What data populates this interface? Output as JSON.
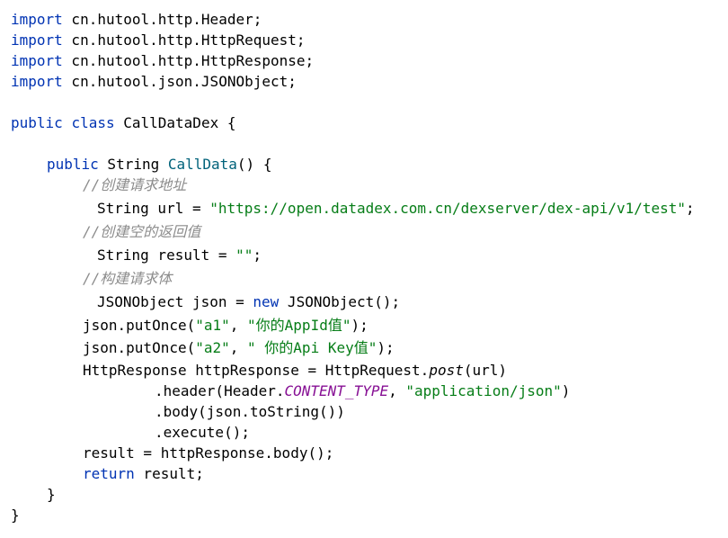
{
  "code": {
    "kw_import": "import",
    "imports": [
      " cn.hutool.http.Header;",
      " cn.hutool.http.HttpRequest;",
      " cn.hutool.http.HttpResponse;",
      " cn.hutool.json.JSONObject;"
    ],
    "kw_public": "public",
    "kw_class": "class",
    "class_name": " CallDataDex {",
    "method_return": " String ",
    "method_name": "CallData",
    "method_tail": "() {",
    "comment1": "//创建请求地址",
    "url_decl": "String url = ",
    "url_value": "\"https://open.datadex.com.cn/dexserver/dex-api/v1/test\"",
    "url_end": ";",
    "comment2": "//创建空的返回值",
    "result_decl": "String result = ",
    "result_value": "\"\"",
    "result_end": ";",
    "comment3": "//构建请求体",
    "json_decl": "JSONObject json = ",
    "kw_new": "new",
    "json_ctor": " JSONObject();",
    "put1_start": "json.putOnce(",
    "put1_key": "\"a1\"",
    "put1_sep": ", ",
    "put1_val": "\"你的AppId值\"",
    "put1_end": ");",
    "put2_start": "json.putOnce(",
    "put2_key": "\"a2\"",
    "put2_sep": ", ",
    "put2_val": "\" 你的Api Key值\"",
    "put2_end": ");",
    "resp_decl": "HttpResponse httpResponse = HttpRequest.",
    "resp_post": "post",
    "resp_tail": "(url)",
    "header_start": ".header(Header.",
    "header_const": "CONTENT_TYPE",
    "header_sep": ", ",
    "header_val": "\"application/json\"",
    "header_end": ")",
    "body_call": ".body(json.toString())",
    "execute_call": ".execute();",
    "result_assign": "result = httpResponse.body();",
    "kw_return": "return",
    "return_tail": " result;",
    "close_method": "}",
    "close_class": "}"
  },
  "colors": {
    "keyword": "#0033b3",
    "string": "#067d17",
    "comment": "#8c8c8c",
    "constant": "#871094",
    "method_decl": "#00627a"
  }
}
